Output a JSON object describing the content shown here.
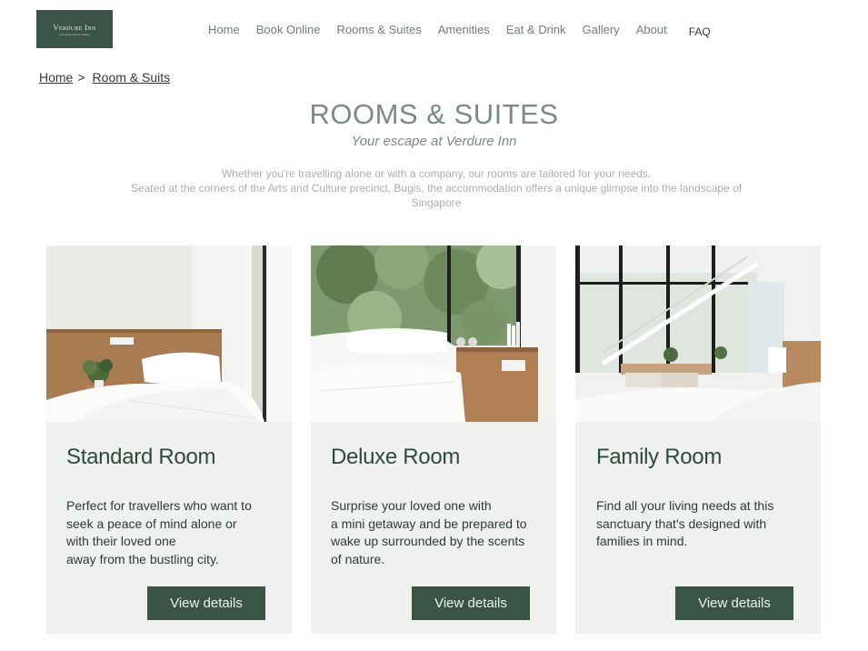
{
  "logo": {
    "name": "Verdure Inn",
    "tagline": "your escape from the ordinary"
  },
  "nav": {
    "items": [
      "Home",
      "Book Online",
      "Rooms & Suites",
      "Amenities",
      "Eat & Drink",
      "Gallery",
      "About"
    ],
    "faq": "FAQ"
  },
  "breadcrumb": {
    "home": "Home",
    "separator": ">",
    "current": "Room & Suits"
  },
  "page": {
    "title": "ROOMS & SUITES",
    "subtitle": "Your escape at Verdure Inn",
    "intro_line1": "Whether you're travelling alone or with a company, our rooms are tailored for your needs.",
    "intro_line2": "Seated at the corners of the Arts and Culture precinct, Bugis, the accommodation offers a unique glimpse into the landscape of",
    "intro_line3": "Singapore"
  },
  "rooms": [
    {
      "title": "Standard Room",
      "description": "Perfect for travellers who want to\nseek a peace of mind alone or\nwith their loved one\naway from the bustling city.",
      "button": "View details"
    },
    {
      "title": "Deluxe Room",
      "description": "Surprise your loved one with\na mini getaway and be prepared to\nwake up surrounded by the scents\nof nature.",
      "button": "View details"
    },
    {
      "title": "Family Room",
      "description": "Find all your living needs at this\nsanctuary that's designed with\nfamilies in mind.",
      "button": "View details"
    }
  ],
  "colors": {
    "brand_green": "#3a5547",
    "card_bg": "#eff1ef",
    "heading_grey": "#7b8b83"
  }
}
